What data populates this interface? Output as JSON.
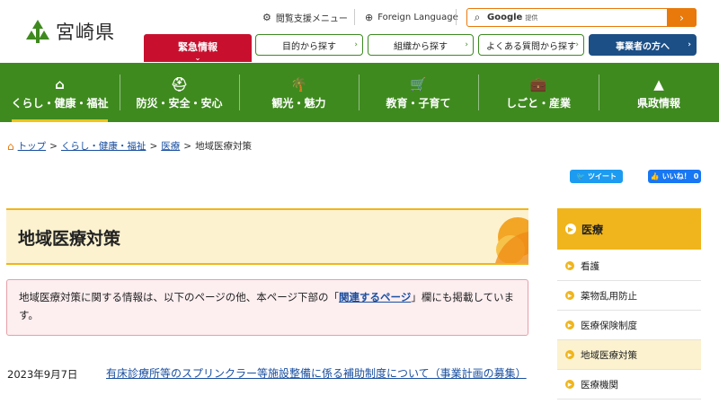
{
  "site": {
    "logo_text": "宮崎県"
  },
  "utility": {
    "reading_support": "閲覧支援メニュー",
    "foreign_language": "Foreign Language"
  },
  "search": {
    "brand": "Google",
    "brand_sub": "提供"
  },
  "header_links": {
    "emergency": "緊急情報",
    "by_purpose": "目的から探す",
    "by_organization": "組織から探す",
    "faq": "よくある質問から探す",
    "business": "事業者の方へ"
  },
  "global_nav": [
    {
      "label": "くらし・健康・福祉",
      "icon": "home-icon"
    },
    {
      "label": "防災・安全・安心",
      "icon": "first-aid-icon"
    },
    {
      "label": "観光・魅力",
      "icon": "palm-tree-icon"
    },
    {
      "label": "教育・子育て",
      "icon": "stroller-icon"
    },
    {
      "label": "しごと・産業",
      "icon": "briefcase-icon"
    },
    {
      "label": "県政情報",
      "icon": "prefecture-emblem-icon"
    }
  ],
  "breadcrumb": {
    "items": [
      "トップ",
      "くらし・健康・福祉",
      "医療"
    ],
    "current": "地域医療対策",
    "separator": ">"
  },
  "social": {
    "tweet": "ツイート",
    "like": "いいね！",
    "like_count": "0"
  },
  "page": {
    "title": "地域医療対策",
    "notice_before": "地域医療対策に関する情報は、以下のページの他、本ページ下部の「",
    "notice_link": "関連するページ",
    "notice_after": "」欄にも掲載しています。"
  },
  "news": [
    {
      "date": "2023年9月7日",
      "title": "有床診療所等のスプリンクラー等施設整備に係る補助制度について（事業計画の募集）"
    }
  ],
  "sidebar": {
    "heading": "医療",
    "items": [
      "看護",
      "薬物乱用防止",
      "医療保険制度",
      "地域医療対策",
      "医療機関"
    ],
    "active_index": 3
  },
  "colors": {
    "nav_green": "#3f8a1f",
    "emergency_red": "#c8102e",
    "accent_orange": "#e8790a",
    "accent_yellow": "#f0b51c",
    "business_navy": "#1c4f86"
  }
}
